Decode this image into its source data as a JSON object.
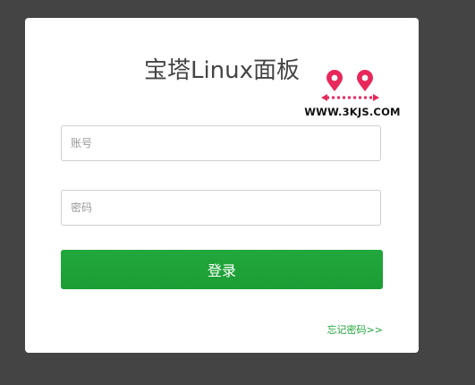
{
  "panel": {
    "title": "宝塔Linux面板"
  },
  "watermark": {
    "text": "WWW.3KJS.COM",
    "pin_color": "#e8275a"
  },
  "form": {
    "username": {
      "placeholder": "账号",
      "value": ""
    },
    "password": {
      "placeholder": "密码",
      "value": ""
    },
    "login_label": "登录",
    "forgot_label": "忘记密码>>"
  },
  "colors": {
    "background": "#444444",
    "primary": "#20a53a"
  }
}
